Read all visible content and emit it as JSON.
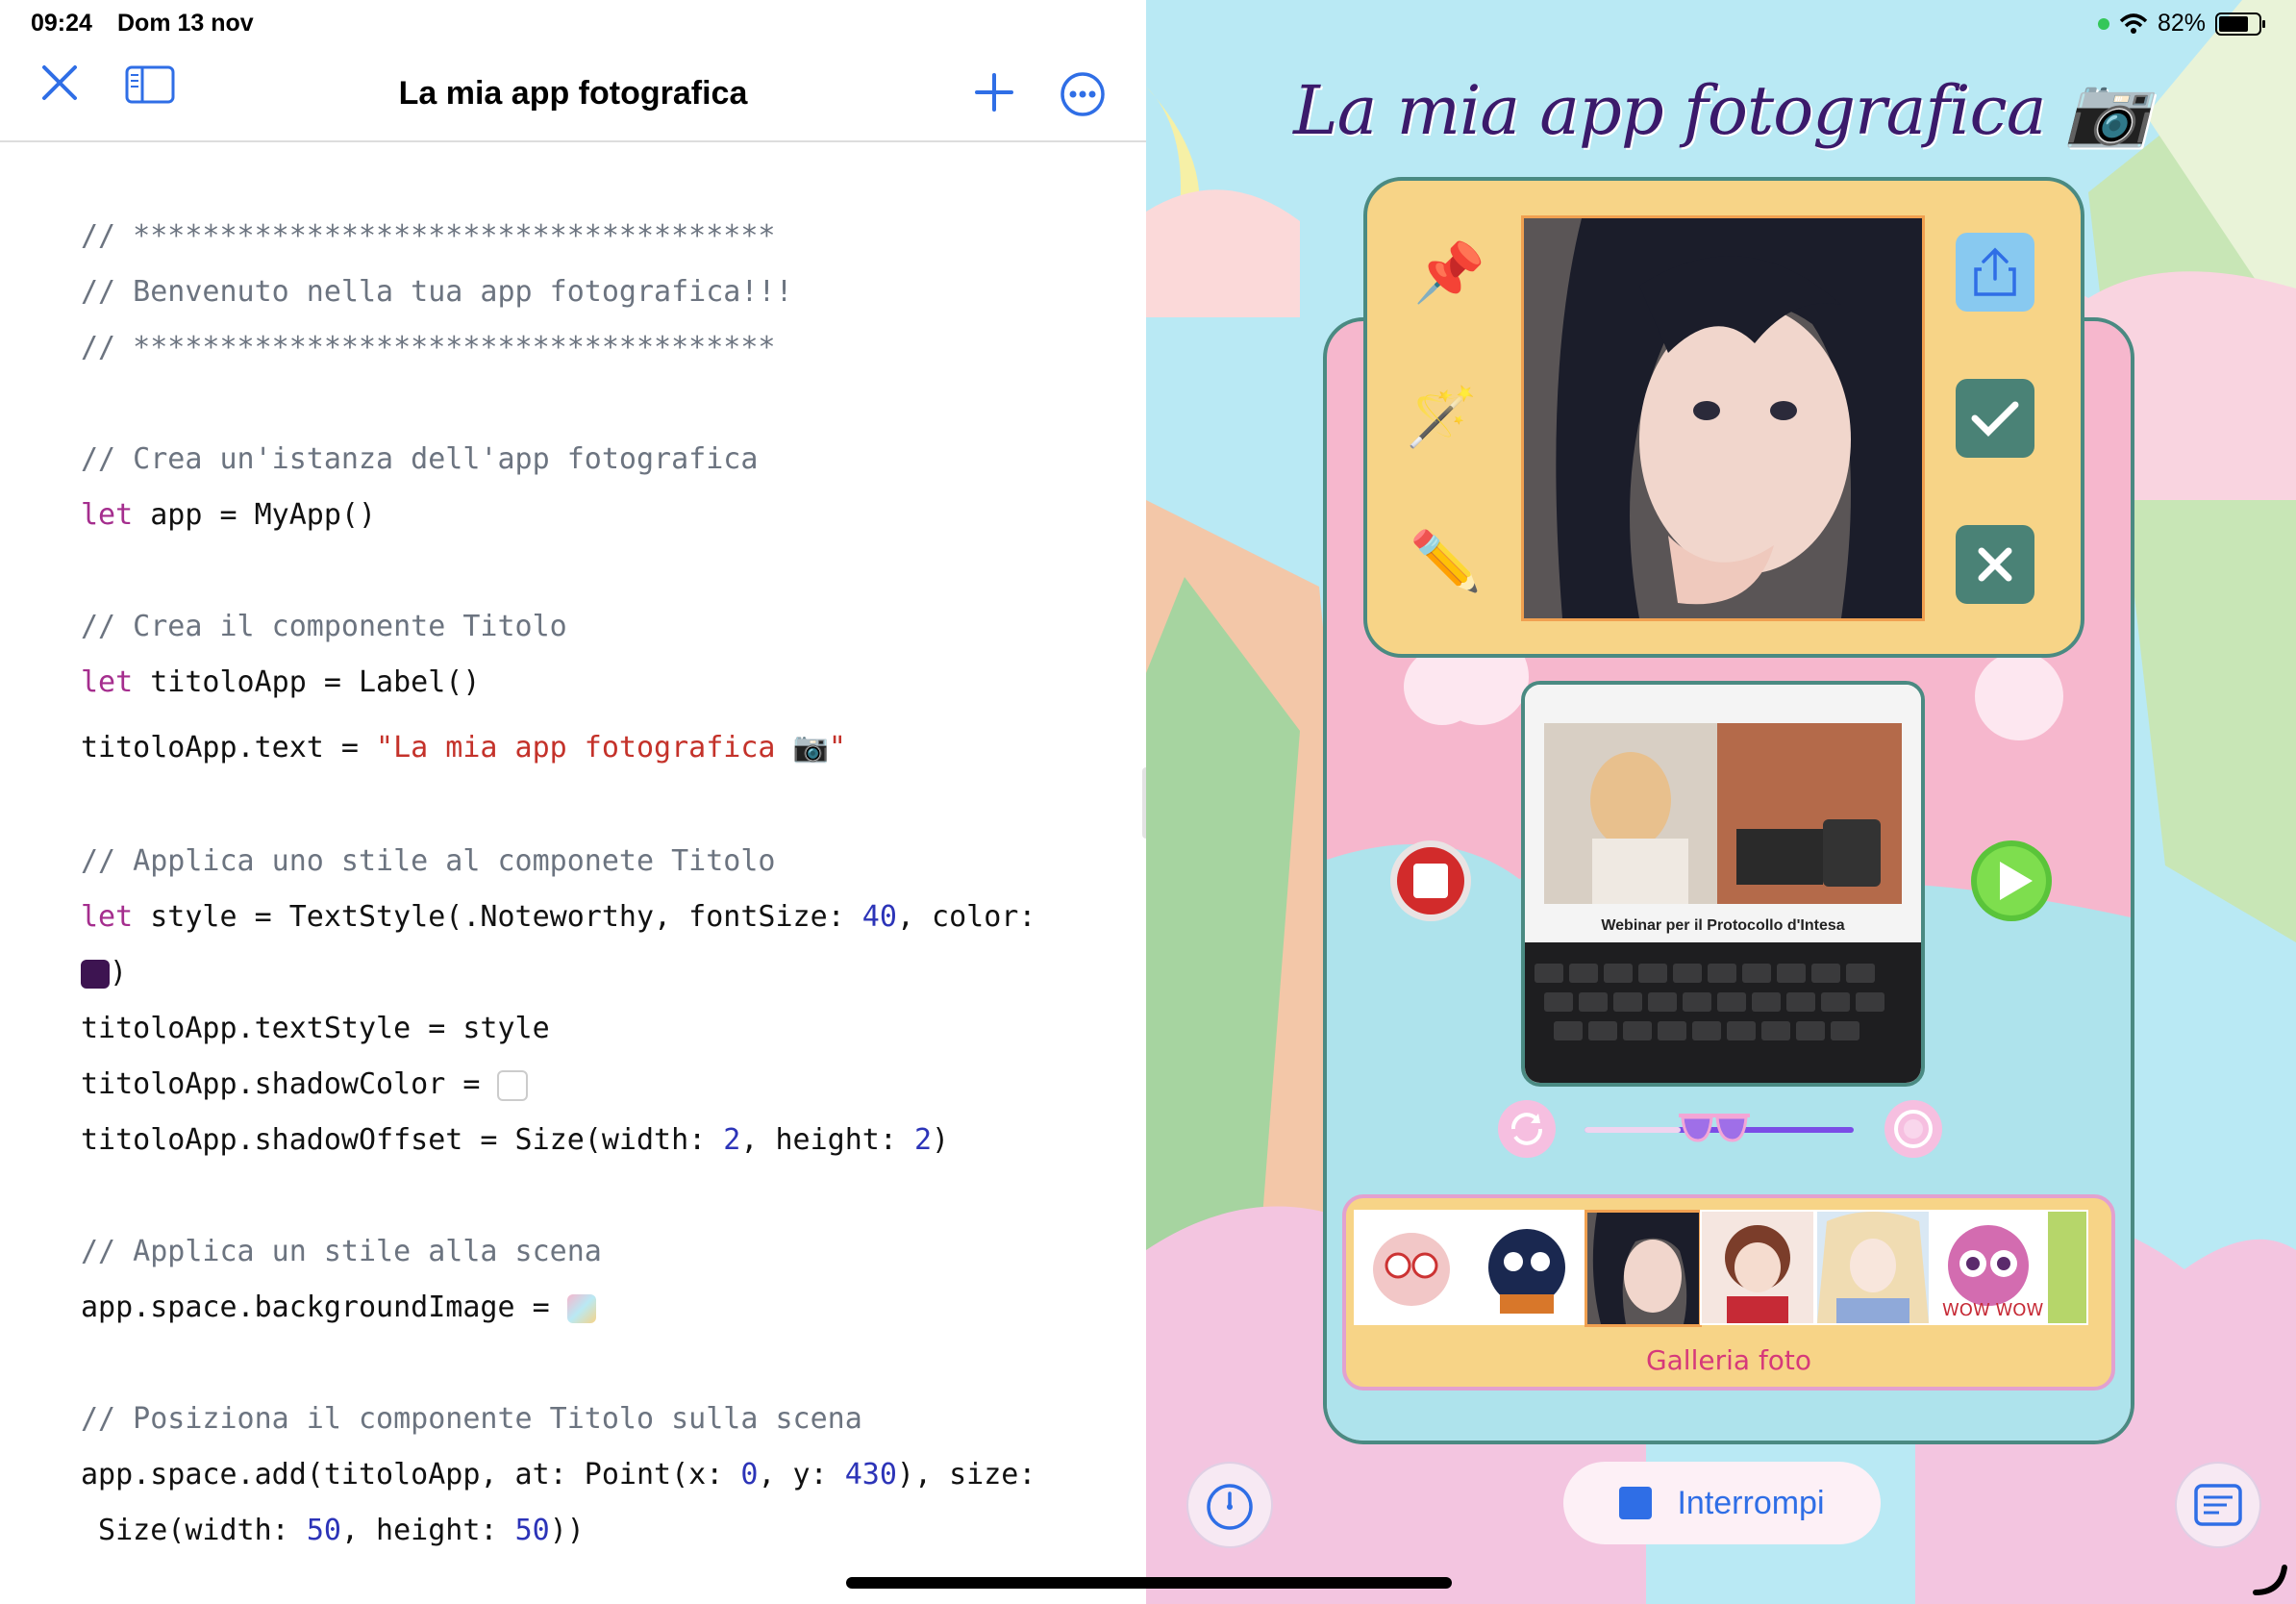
{
  "status": {
    "time": "09:24",
    "date": "Dom 13 nov",
    "battery": "82%"
  },
  "editor": {
    "title": "La mia app fotografica",
    "lines": [
      {
        "kind": "comment",
        "text": "// *************************************"
      },
      {
        "kind": "comment",
        "text": "// Benvenuto nella tua app fotografica!!!"
      },
      {
        "kind": "comment",
        "text": "// *************************************"
      },
      {
        "kind": "comment",
        "text": "// Crea un'istanza dell'app fotografica"
      },
      {
        "kind": "code",
        "kw": "let",
        "text": " app = MyApp()"
      },
      {
        "kind": "comment",
        "text": "// Crea il componente Titolo"
      },
      {
        "kind": "code",
        "kw": "let",
        "text": " titoloApp = Label()"
      },
      {
        "kind": "assign",
        "text": "titoloApp.text = ",
        "str": "\"La mia app fotografica 📷\""
      },
      {
        "kind": "comment",
        "text": "// Applica uno stile al componete Titolo"
      },
      {
        "kind": "style",
        "kw": "let",
        "pre": " style = TextStyle(.Noteworthy, fontSize: ",
        "num": "40",
        "post": ", color:"
      },
      {
        "kind": "swatch-dark",
        "text": ")"
      },
      {
        "kind": "plain",
        "text": "titoloApp.textStyle = style"
      },
      {
        "kind": "plain",
        "text": "titoloApp.shadowColor = "
      },
      {
        "kind": "size",
        "pre": "titoloApp.shadowOffset = Size(width: ",
        "n1": "2",
        "mid": ", height: ",
        "n2": "2",
        "post": ")"
      },
      {
        "kind": "comment",
        "text": "// Applica un stile alla scena"
      },
      {
        "kind": "plain",
        "text": "app.space.backgroundImage = "
      },
      {
        "kind": "comment",
        "text": "// Posiziona il componente Titolo sulla scena"
      },
      {
        "kind": "point",
        "pre": "app.space.add(titoloApp, at: Point(x: ",
        "n1": "0",
        "mid": ", y: ",
        "n2": "430",
        "post": "), size:"
      },
      {
        "kind": "size2",
        "pre": " Size(width: ",
        "n1": "50",
        "mid": ", height: ",
        "n2": "50",
        "post": "))"
      }
    ]
  },
  "preview": {
    "title": "La mia app fotografica 📷",
    "video_caption": "Webinar per il Protocollo d'Intesa",
    "gallery_label": "Galleria foto",
    "stop_label": "Interrompi"
  },
  "colors": {
    "accent": "#2f6ee6",
    "keyword": "#a52e8e",
    "number": "#2c34b8",
    "string": "#c4322a",
    "title_color": "#3b1a6b"
  }
}
